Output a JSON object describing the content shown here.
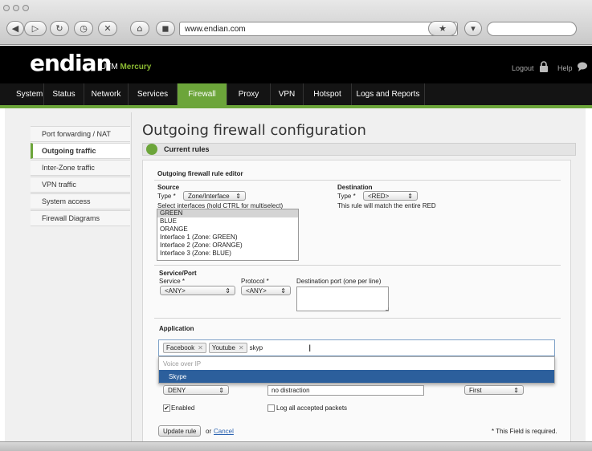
{
  "browser": {
    "url": "www.endian.com"
  },
  "header": {
    "logo": "endian",
    "product_prefix": "UTM",
    "product_name": "Mercury",
    "logout_label": "Logout",
    "help_label": "Help"
  },
  "menu": {
    "items": [
      {
        "label": "System"
      },
      {
        "label": "Status"
      },
      {
        "label": "Network"
      },
      {
        "label": "Services"
      },
      {
        "label": "Firewall"
      },
      {
        "label": "Proxy"
      },
      {
        "label": "VPN"
      },
      {
        "label": "Hotspot"
      },
      {
        "label": "Logs and Reports"
      }
    ],
    "active": "Firewall"
  },
  "sidebar": {
    "items": [
      {
        "label": "Port forwarding / NAT"
      },
      {
        "label": "Outgoing traffic"
      },
      {
        "label": "Inter-Zone traffic"
      },
      {
        "label": "VPN traffic"
      },
      {
        "label": "System access"
      },
      {
        "label": "Firewall Diagrams"
      }
    ],
    "active": "Outgoing traffic"
  },
  "main": {
    "title": "Outgoing firewall configuration",
    "section_label": "Current rules",
    "editor_title": "Outgoing firewall rule editor",
    "source": {
      "heading": "Source",
      "type_label": "Type *",
      "type_value": "Zone/Interface",
      "select_hint": "Select interfaces (hold CTRL for multiselect)",
      "interfaces": [
        "GREEN",
        "BLUE",
        "ORANGE",
        "Interface 1 (Zone: GREEN)",
        "Interface 2 (Zone: ORANGE)",
        "Interface 3 (Zone: BLUE)"
      ]
    },
    "destination": {
      "heading": "Destination",
      "type_label": "Type *",
      "type_value": "<RED>",
      "note": "This rule will match the entire RED"
    },
    "service": {
      "heading": "Service/Port",
      "service_label": "Service *",
      "service_value": "<ANY>",
      "protocol_label": "Protocol *",
      "protocol_value": "<ANY>",
      "dest_port_label": "Destination port (one per line)"
    },
    "application": {
      "heading": "Application",
      "tags": [
        "Facebook",
        "Youtube"
      ],
      "tag_remove": "✕",
      "typed": "skyp",
      "dropdown_group": "Voice over IP",
      "dropdown_option": "Skype"
    },
    "policy": {
      "action_value": "DENY",
      "remark_value": "no distraction",
      "position_value": "First"
    },
    "enabled_label": "Enabled",
    "log_label": "Log all accepted packets",
    "update_button": "Update rule",
    "or_text": "or",
    "cancel_link": "Cancel",
    "required_note": "* This Field is required."
  }
}
